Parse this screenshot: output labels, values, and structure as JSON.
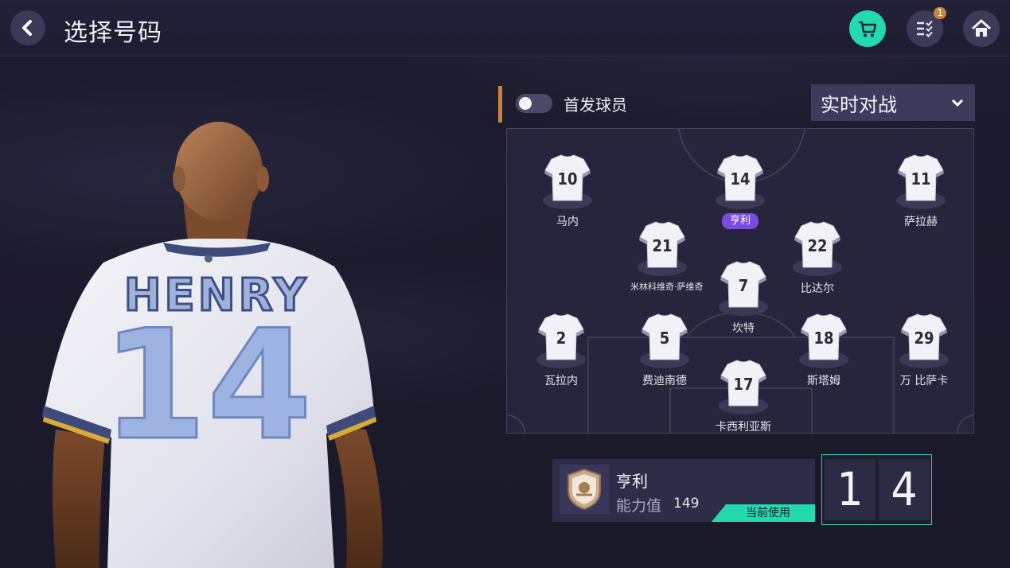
{
  "header": {
    "title": "选择号码",
    "tasks_badge": "1"
  },
  "icons": {
    "back": "chevron-left-icon",
    "shop": "cart-icon",
    "tasks": "checklist-icon",
    "home": "home-icon"
  },
  "colors": {
    "accent_teal": "#23d9b0",
    "accent_purple": "#7a4bdc",
    "accent_orange": "#c9843a"
  },
  "player_art": {
    "shirt_name": "HENRY",
    "shirt_number": "14"
  },
  "panel": {
    "toggle_label": "首发球员",
    "toggle_on": false,
    "mode": "实时对战"
  },
  "lineup": [
    {
      "number": "10",
      "name": "马内"
    },
    {
      "number": "14",
      "name": "亨利",
      "selected": true
    },
    {
      "number": "11",
      "name": "萨拉赫"
    },
    {
      "number": "21",
      "name": "米林科维奇·萨维奇"
    },
    {
      "number": "22",
      "name": "比达尔"
    },
    {
      "number": "7",
      "name": "坎特"
    },
    {
      "number": "2",
      "name": "瓦拉内"
    },
    {
      "number": "5",
      "name": "费迪南德"
    },
    {
      "number": "18",
      "name": "斯塔姆"
    },
    {
      "number": "29",
      "name": "万 比萨卡"
    },
    {
      "number": "17",
      "name": "卡西利亚斯"
    }
  ],
  "card": {
    "name": "亨利",
    "power_label": "能力值",
    "power_value": "149",
    "status": "当前使用"
  },
  "number_digits": [
    "1",
    "4"
  ]
}
